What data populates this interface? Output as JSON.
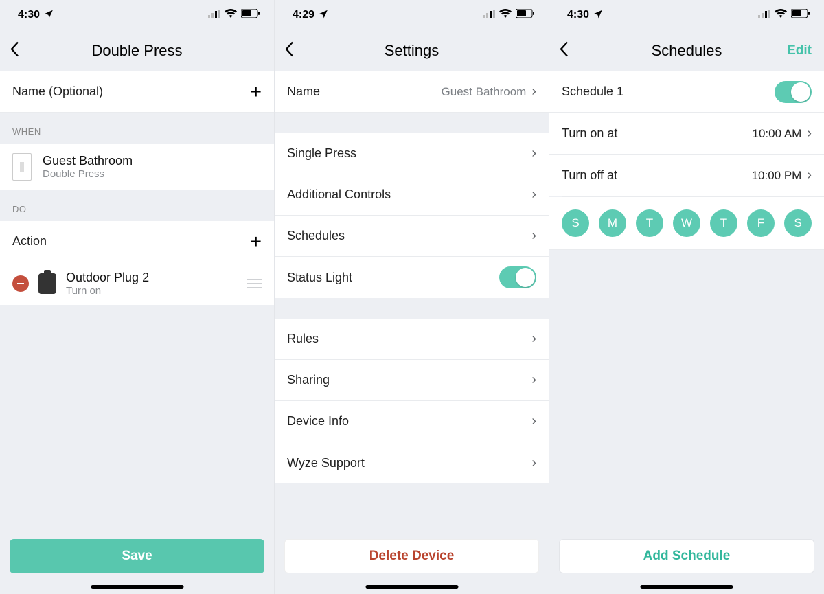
{
  "screen1": {
    "status_time": "4:30",
    "title": "Double Press",
    "name_field": {
      "label": "Name (Optional)"
    },
    "section_when": "WHEN",
    "trigger": {
      "device": "Guest Bathroom",
      "action": "Double Press"
    },
    "section_do": "DO",
    "action_label": "Action",
    "action_item": {
      "device": "Outdoor Plug 2",
      "action": "Turn on"
    },
    "save_btn": "Save"
  },
  "screen2": {
    "status_time": "4:29",
    "title": "Settings",
    "rows": {
      "name": {
        "label": "Name",
        "value": "Guest Bathroom"
      },
      "single_press": "Single Press",
      "additional_controls": "Additional Controls",
      "schedules": "Schedules",
      "status_light": "Status Light",
      "rules": "Rules",
      "sharing": "Sharing",
      "device_info": "Device Info",
      "wyze_support": "Wyze Support"
    },
    "delete_btn": "Delete Device"
  },
  "screen3": {
    "status_time": "4:30",
    "title": "Schedules",
    "edit_btn": "Edit",
    "schedule_name": "Schedule 1",
    "turn_on": {
      "label": "Turn on at",
      "value": "10:00 AM"
    },
    "turn_off": {
      "label": "Turn off at",
      "value": "10:00 PM"
    },
    "days": [
      "S",
      "M",
      "T",
      "W",
      "T",
      "F",
      "S"
    ],
    "add_btn": "Add Schedule"
  }
}
